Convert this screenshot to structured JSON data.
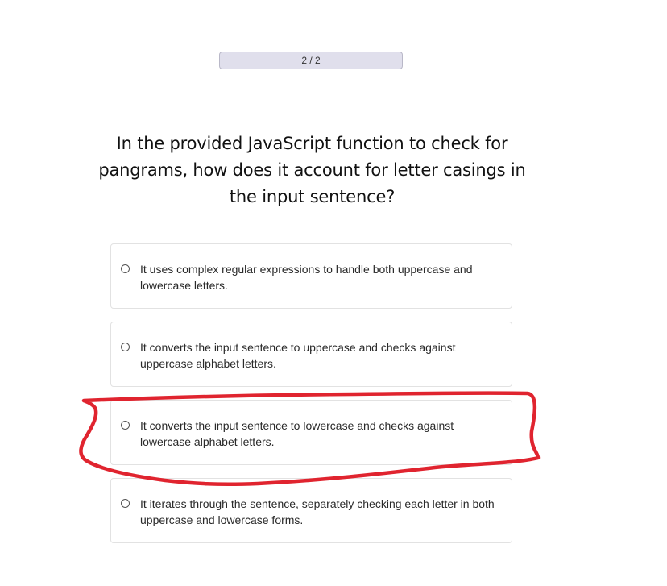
{
  "progress": {
    "label": "2 / 2"
  },
  "question": {
    "text": "In the provided JavaScript function to check for pangrams, how does it account for letter casings in the input sentence?"
  },
  "options": [
    {
      "label": "It uses complex regular expressions to handle both uppercase and lowercase letters."
    },
    {
      "label": "It converts the input sentence to uppercase and checks against uppercase alphabet letters."
    },
    {
      "label": "It converts the input sentence to lowercase and checks against lowercase alphabet letters."
    },
    {
      "label": "It iterates through the sentence, separately checking each letter in both uppercase and lowercase forms."
    }
  ],
  "annotation": {
    "color": "#e0242f",
    "highlighted_option_index": 2
  }
}
